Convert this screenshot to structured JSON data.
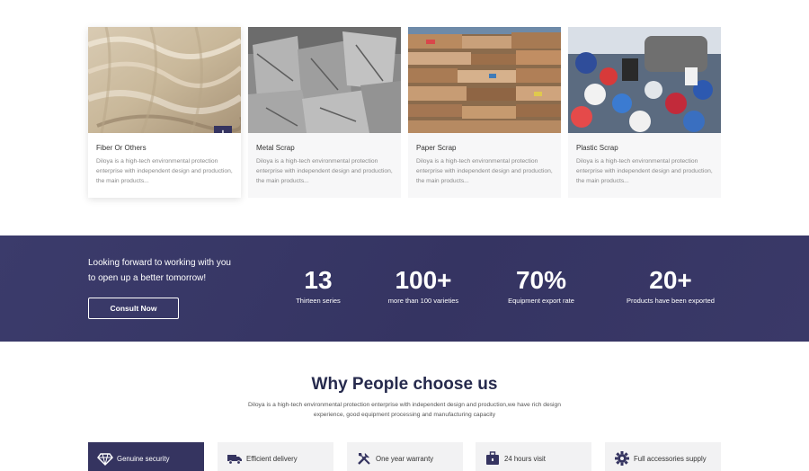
{
  "products": [
    {
      "title": "Fiber Or Others",
      "desc": "Diloya is a high-tech environmental protection enterprise with independent design and production, the main products..."
    },
    {
      "title": "Metal Scrap",
      "desc": "Diloya is a high-tech environmental protection enterprise with independent design and production, the main products..."
    },
    {
      "title": "Paper Scrap",
      "desc": "Diloya is a high-tech environmental protection enterprise with independent design and production, the main products..."
    },
    {
      "title": "Plastic Scrap",
      "desc": "Diloya is a high-tech environmental protection enterprise with independent design and production, the main products..."
    }
  ],
  "expand_icon": "+",
  "band": {
    "tagline_line1": "Looking forward to working with you",
    "tagline_line2": "to open up a better tomorrow!",
    "cta": "Consult Now",
    "stats": [
      {
        "value": "13",
        "label": "Thirteen series"
      },
      {
        "value": "100+",
        "label": "more than 100 varieties"
      },
      {
        "value": "70%",
        "label": "Equipment export rate"
      },
      {
        "value": "20+",
        "label": "Products have been exported"
      }
    ]
  },
  "why": {
    "title": "Why People choose us",
    "desc_line1": "Diloya is a high-tech environmental protection enterprise with independent design and production,we have rich design",
    "desc_line2": "experience, good equipment processing and manufacturing capacity"
  },
  "features": [
    {
      "label": "Genuine security",
      "icon": "diamond-icon"
    },
    {
      "label": "Efficient delivery",
      "icon": "truck-icon"
    },
    {
      "label": "One year warranty",
      "icon": "tools-icon"
    },
    {
      "label": "24 hours visit",
      "icon": "briefcase-icon"
    },
    {
      "label": "Full accessories supply",
      "icon": "gear-icon"
    }
  ],
  "colors": {
    "brand": "#353460",
    "card_bg": "#f7f7f8",
    "feature_bg": "#f2f2f3"
  }
}
